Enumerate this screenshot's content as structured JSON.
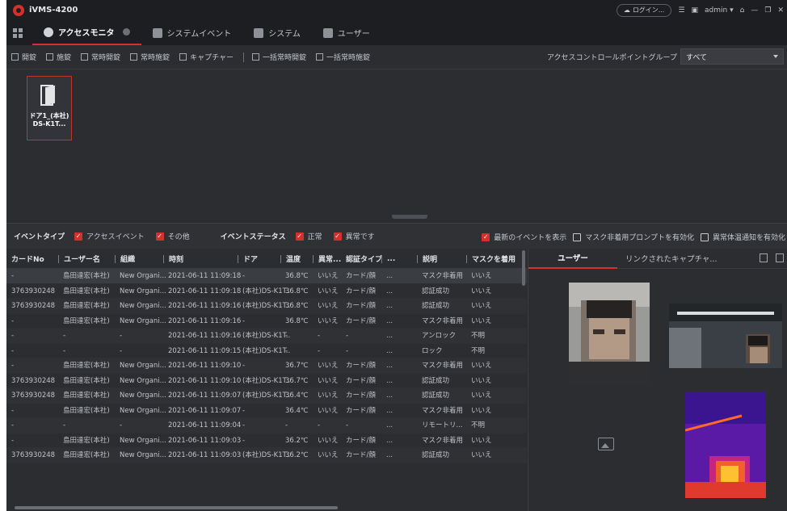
{
  "app": {
    "title": "iVMS-4200"
  },
  "titlebar": {
    "login_label": "ログイン...",
    "user": "admin"
  },
  "tabs": [
    {
      "label": "アクセスモニタ"
    },
    {
      "label": "システムイベント"
    },
    {
      "label": "システム"
    },
    {
      "label": "ユーザー"
    }
  ],
  "toolbar": {
    "open": "開錠",
    "close": "施錠",
    "remain_open": "常時開錠",
    "remain_closed": "常時施錠",
    "capture": "キャプチャー",
    "all_remain_open": "一括常時開錠",
    "all_remain_closed": "一括常時施錠",
    "group_label": "アクセスコントロールポイントグループ",
    "group_value": "すべて"
  },
  "door": {
    "line1": "ドア1_(本社)",
    "line2": "DS-K1T..."
  },
  "filters": {
    "event_type_label": "イベントタイプ",
    "access_event": "アクセスイベント",
    "other": "その他",
    "event_status_label": "イベントステータス",
    "normal": "正常",
    "abnormal": "異常です",
    "show_latest": "最新のイベントを表示",
    "mask_prompt": "マスク非着用プロンプトを有効化",
    "abnormal_temp": "異常体温通知を有効化"
  },
  "table": {
    "headers": [
      "カードNo",
      "ユーザー名",
      "組織",
      "時刻",
      "ドア",
      "温度",
      "異常...",
      "認証タイプ",
      "...",
      "説明",
      "マスクを着用"
    ],
    "rows": [
      [
        "-",
        "島田達宏(本社)",
        "New Organi...",
        "2021-06-11 11:09:18",
        "-",
        "36.8℃",
        "いいえ",
        "カード/顔",
        "...",
        "マスク非着用",
        "いいえ"
      ],
      [
        "3763930248",
        "島田達宏(本社)",
        "New Organi...",
        "2021-06-11 11:09:18",
        "(本社)DS-K1T...",
        "36.8℃",
        "いいえ",
        "カード/顔",
        "...",
        "認証成功",
        "いいえ"
      ],
      [
        "3763930248",
        "島田達宏(本社)",
        "New Organi...",
        "2021-06-11 11:09:16",
        "(本社)DS-K1T...",
        "36.8℃",
        "いいえ",
        "カード/顔",
        "...",
        "認証成功",
        "いいえ"
      ],
      [
        "-",
        "島田達宏(本社)",
        "New Organi...",
        "2021-06-11 11:09:16",
        "-",
        "36.8℃",
        "いいえ",
        "カード/顔",
        "...",
        "マスク非着用",
        "いいえ"
      ],
      [
        "-",
        "-",
        "-",
        "2021-06-11 11:09:16",
        "(本社)DS-K1T...",
        "-",
        "-",
        "-",
        "...",
        "アンロック",
        "不明"
      ],
      [
        "-",
        "-",
        "-",
        "2021-06-11 11:09:15",
        "(本社)DS-K1T...",
        "-",
        "-",
        "-",
        "...",
        "ロック",
        "不明"
      ],
      [
        "-",
        "島田達宏(本社)",
        "New Organi...",
        "2021-06-11 11:09:10",
        "-",
        "36.7℃",
        "いいえ",
        "カード/顔",
        "...",
        "マスク非着用",
        "いいえ"
      ],
      [
        "3763930248",
        "島田達宏(本社)",
        "New Organi...",
        "2021-06-11 11:09:10",
        "(本社)DS-K1T...",
        "36.7℃",
        "いいえ",
        "カード/顔",
        "...",
        "認証成功",
        "いいえ"
      ],
      [
        "3763930248",
        "島田達宏(本社)",
        "New Organi...",
        "2021-06-11 11:09:07",
        "(本社)DS-K1T...",
        "36.4℃",
        "いいえ",
        "カード/顔",
        "...",
        "認証成功",
        "いいえ"
      ],
      [
        "-",
        "島田達宏(本社)",
        "New Organi...",
        "2021-06-11 11:09:07",
        "-",
        "36.4℃",
        "いいえ",
        "カード/顔",
        "...",
        "マスク非着用",
        "いいえ"
      ],
      [
        "-",
        "-",
        "-",
        "2021-06-11 11:09:04",
        "-",
        "-",
        "-",
        "-",
        "...",
        "リモートリ...",
        "不明"
      ],
      [
        "-",
        "島田達宏(本社)",
        "New Organi...",
        "2021-06-11 11:09:03",
        "-",
        "36.2℃",
        "いいえ",
        "カード/顔",
        "...",
        "マスク非着用",
        "いいえ"
      ],
      [
        "3763930248",
        "島田達宏(本社)",
        "New Organi...",
        "2021-06-11 11:09:03",
        "(本社)DS-K1T...",
        "36.2℃",
        "いいえ",
        "カード/顔",
        "...",
        "認証成功",
        "いいえ"
      ]
    ]
  },
  "rpanel": {
    "tab_user": "ユーザー",
    "tab_linked": "リンクされたキャプチャ..."
  },
  "colors": {
    "accent": "#d4312e",
    "background": "#2b2d31",
    "titlebar": "#1d1e21"
  }
}
